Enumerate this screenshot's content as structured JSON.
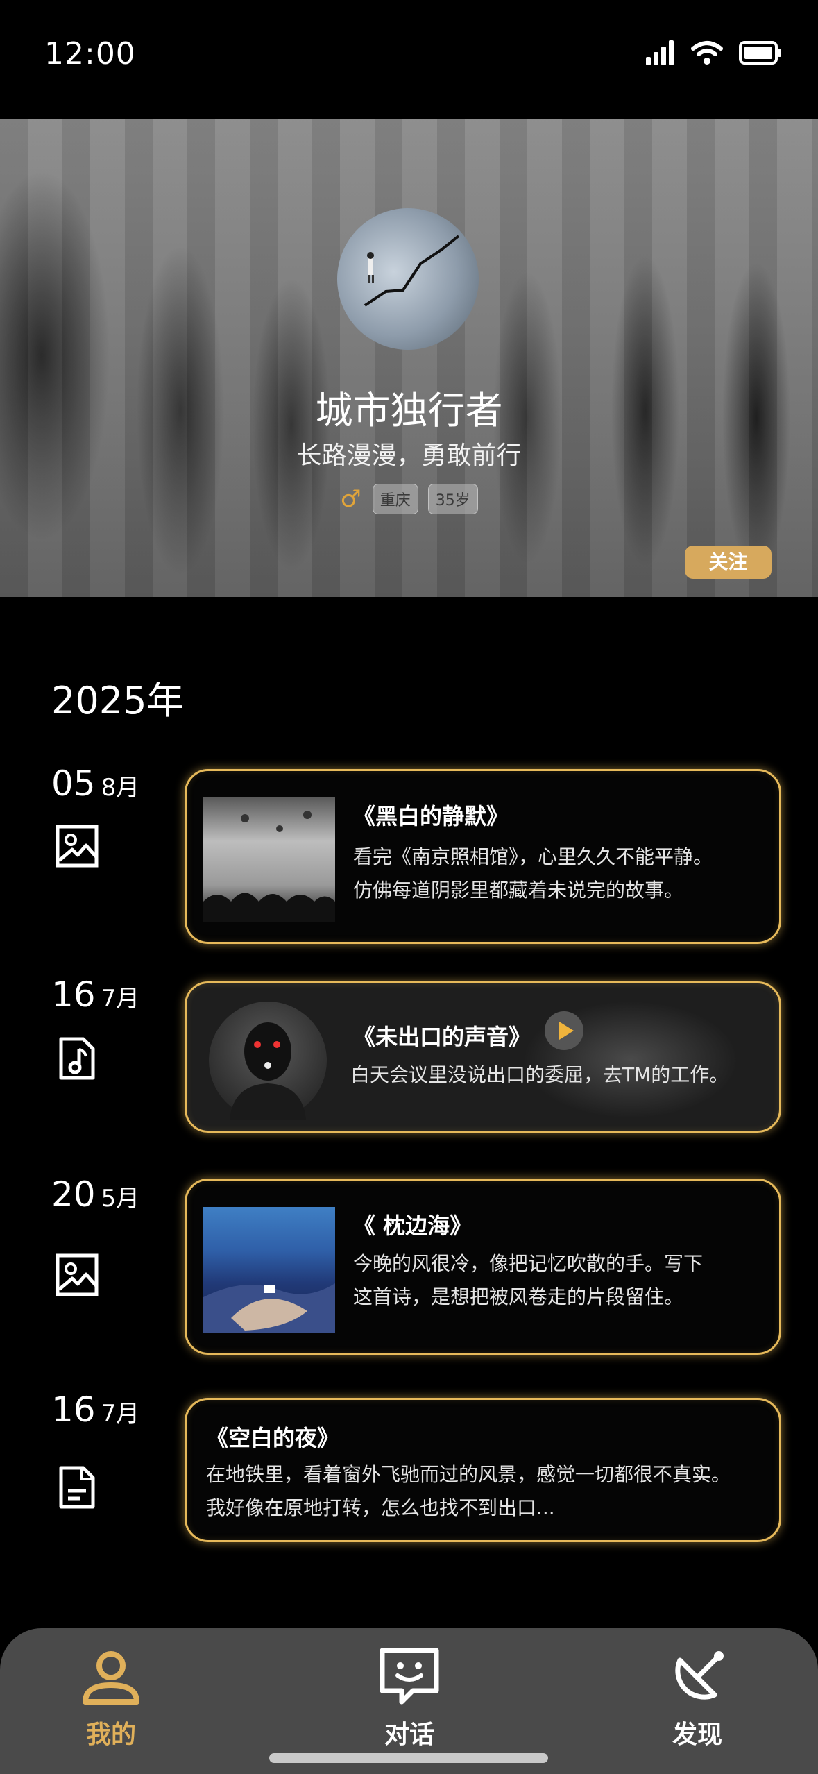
{
  "status_bar": {
    "time": "12:00",
    "icons": [
      "signal-icon",
      "wifi-icon",
      "battery-icon"
    ]
  },
  "profile": {
    "name": "城市独行者",
    "motto": "长路漫漫，勇敢前行",
    "gender_symbol": "♂",
    "location": "重庆",
    "age": "35岁",
    "follow_label": "关注"
  },
  "timeline": {
    "year": "2025年",
    "entries": [
      {
        "day": "05",
        "month": "8月",
        "icon": "image-icon",
        "title": "《黑白的静默》",
        "lines": [
          "看完《南京照相馆》，心里久久不能平静。",
          "仿佛每道阴影里都藏着未说完的故事。"
        ]
      },
      {
        "day": "16",
        "month": "7月",
        "icon": "music-file-icon",
        "title": "《未出口的声音》",
        "lines": [
          "白天会议里没说出口的委屈，去TM的工作。"
        ]
      },
      {
        "day": "20",
        "month": "5月",
        "icon": "image-icon",
        "title": "《 枕边海》",
        "lines": [
          "今晚的风很冷，像把记忆吹散的手。写下",
          "这首诗，是想把被风卷走的片段留住。"
        ]
      },
      {
        "day": "16",
        "month": "7月",
        "icon": "document-icon",
        "title": "《空白的夜》",
        "lines": [
          "在地铁里，看着窗外飞驰而过的风景，感觉一切都很不真实。",
          "我好像在原地打转，怎么也找不到出口..."
        ]
      }
    ]
  },
  "tab_bar": {
    "tabs": [
      {
        "label": "我的",
        "icon": "person-icon",
        "active": true
      },
      {
        "label": "对话",
        "icon": "chat-icon",
        "active": false
      },
      {
        "label": "发现",
        "icon": "satellite-dish-icon",
        "active": false
      }
    ]
  },
  "colors": {
    "accent": "#e0b05a",
    "card_border": "#e6b95a",
    "tab_bar_bg": "#4a4a4a",
    "background": "#000000"
  }
}
